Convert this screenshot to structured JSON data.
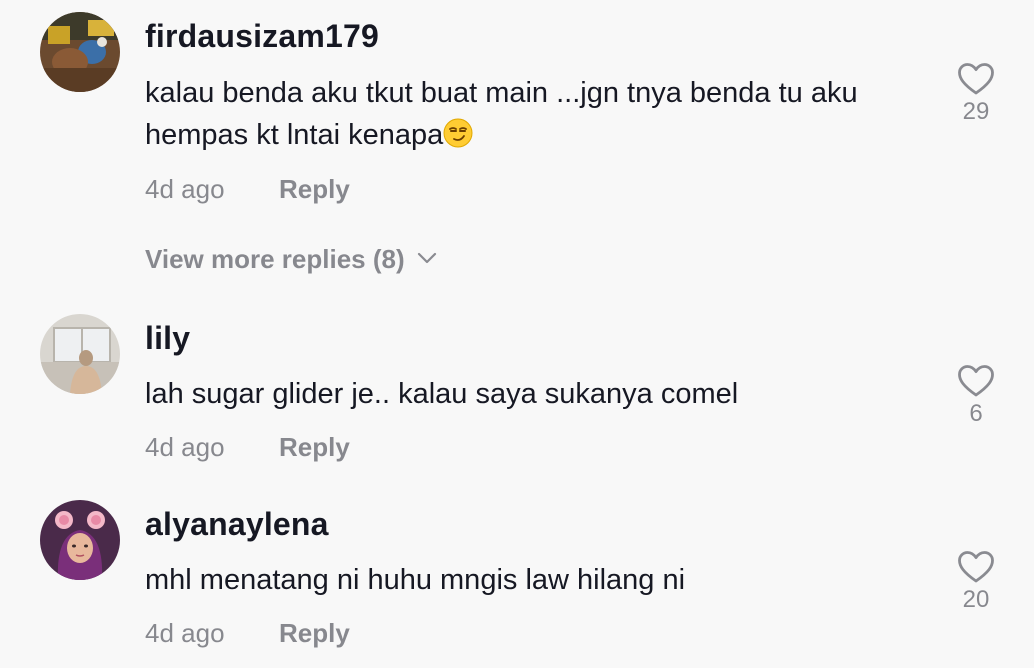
{
  "comments": [
    {
      "username": "firdausizam179",
      "text": "kalau benda aku tkut buat main ...jgn tnya benda tu aku hempas kt lntai kenapa",
      "emoji": "smirking-face",
      "time": "4d ago",
      "reply_label": "Reply",
      "likes": "29"
    },
    {
      "username": "lily",
      "text": "lah sugar glider je.. kalau saya sukanya comel",
      "time": "4d ago",
      "reply_label": "Reply",
      "likes": "6"
    },
    {
      "username": "alyanaylena",
      "text": "mhl menatang ni huhu mngis law hilang ni",
      "time": "4d ago",
      "reply_label": "Reply",
      "likes": "20"
    }
  ],
  "view_more_replies": {
    "label": "View more replies (8)",
    "icon": "chevron-down-icon"
  },
  "icons": {
    "like": "heart-outline-icon"
  },
  "colors": {
    "background": "#f8f8f8",
    "primary_text": "#161823",
    "secondary_text": "#8a8b91"
  }
}
